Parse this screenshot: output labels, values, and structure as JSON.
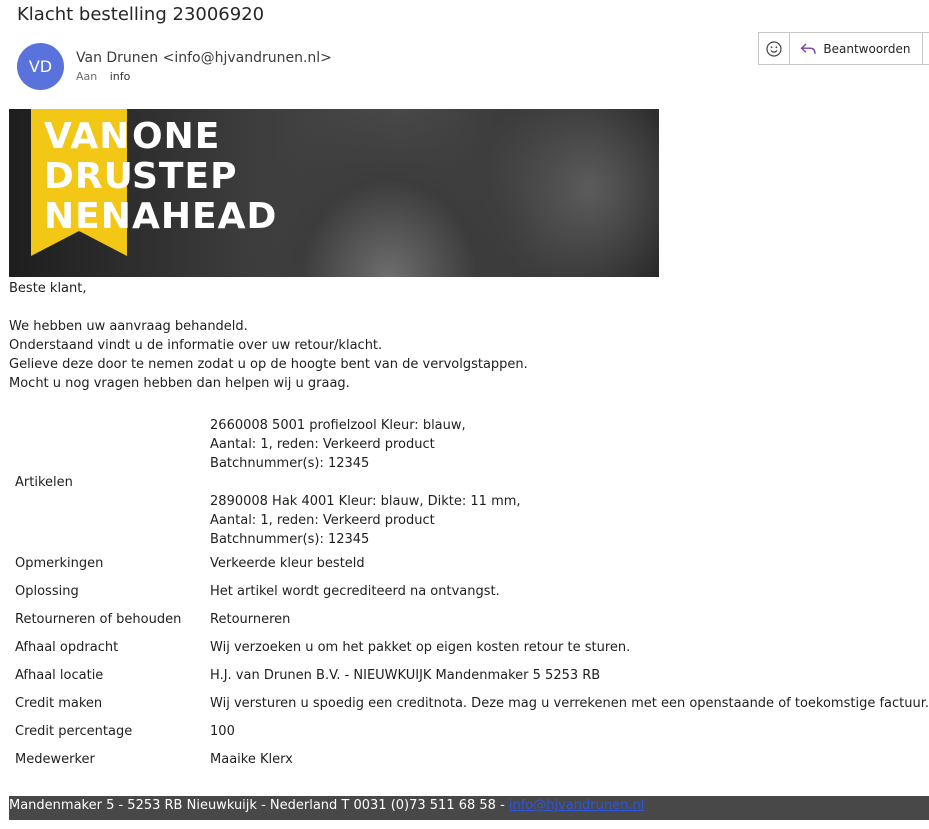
{
  "email": {
    "subject": "Klacht bestelling 23006920",
    "avatar_initials": "VD",
    "avatar_color": "#5a72dc",
    "sender": "Van Drunen <info@hjvandrunen.nl>",
    "to_label": "Aan",
    "to_value": "info"
  },
  "actions": {
    "emoji_icon": "smiley-icon",
    "reply_icon": "reply-arrow-icon",
    "reply_label": "Beantwoorden",
    "more_icon": "chevron-down-icon"
  },
  "banner": {
    "logo_left": [
      "VAN",
      "DRU",
      "NEN"
    ],
    "logo_right": [
      "ONE",
      "STEP",
      "AHEAD"
    ],
    "ribbon_color": "#f2c715"
  },
  "body": {
    "greeting": "Beste klant,",
    "paragraphs": [
      "We hebben uw aanvraag behandeld.",
      "Onderstaand vindt u de informatie over uw retour/klacht.",
      "Gelieve deze door te nemen zodat u op de hoogte bent van de vervolgstappen.",
      "Mocht u nog vragen hebben dan helpen wij u graag."
    ]
  },
  "details": {
    "articles_label": "Artikelen",
    "articles": [
      [
        "2660008 5001 profielzool Kleur: blauw,",
        "Aantal: 1, reden: Verkeerd product",
        "Batchnummer(s): 12345"
      ],
      [
        "2890008 Hak 4001 Kleur: blauw, Dikte: 11 mm,",
        "Aantal: 1, reden: Verkeerd product",
        "Batchnummer(s): 12345"
      ]
    ],
    "rows": [
      {
        "label": "Opmerkingen",
        "value": "Verkeerde kleur besteld"
      },
      {
        "label": "Oplossing",
        "value": "Het artikel wordt gecrediteerd na ontvangst."
      },
      {
        "label": "Retourneren of behouden",
        "value": "Retourneren"
      },
      {
        "label": "Afhaal opdracht",
        "value": "Wij verzoeken u om het pakket op eigen kosten retour te sturen."
      },
      {
        "label": "Afhaal locatie",
        "value": "H.J. van Drunen B.V. - NIEUWKUIJK Mandenmaker 5 5253 RB"
      },
      {
        "label": "Credit maken",
        "value": "Wij versturen u spoedig een creditnota. Deze mag u verrekenen met een openstaande of toekomstige factuur."
      },
      {
        "label": "Credit percentage",
        "value": "100"
      },
      {
        "label": "Medewerker",
        "value": "Maaike Klerx"
      }
    ]
  },
  "footer": {
    "text": "Mandenmaker 5 - 5253 RB Nieuwkuijk - Nederland T 0031 (0)73 511 68 58 - ",
    "email_link": "info@hjvandrunen.nl"
  }
}
